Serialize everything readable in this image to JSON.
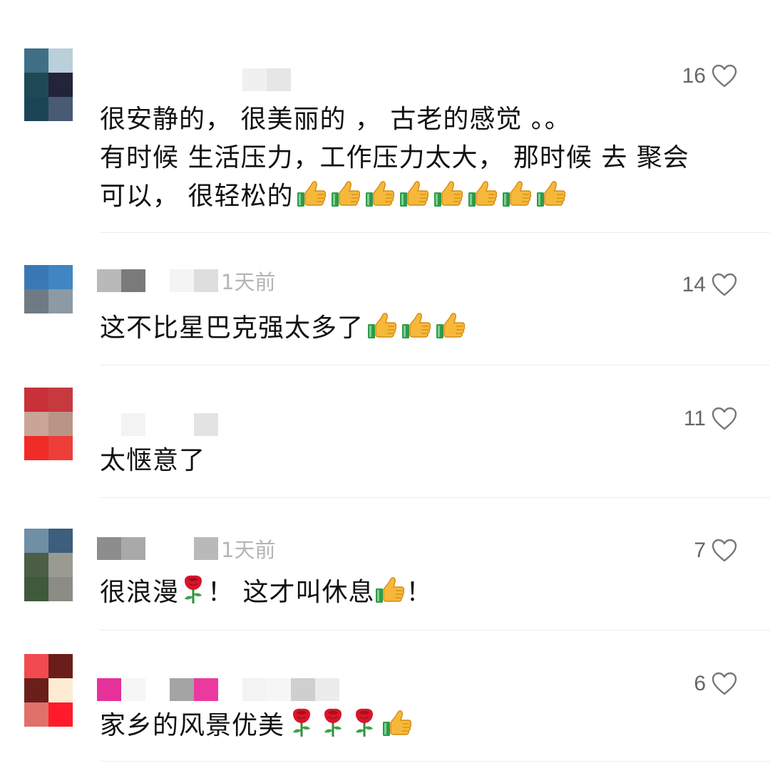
{
  "comments": [
    {
      "time": "",
      "likes": "16",
      "lines": [
        "很安静的， 很美丽的 ， 古老的感觉 。。",
        "有时候 生活压力，工作压力太大， 那时候 去 聚会",
        "可以， 很轻松的"
      ],
      "trailing_emoji": [
        "thumbs-up",
        "thumbs-up",
        "thumbs-up",
        "thumbs-up",
        "thumbs-up",
        "thumbs-up",
        "thumbs-up",
        "thumbs-up"
      ]
    },
    {
      "time": "1天前",
      "likes": "14",
      "lines": [
        "这不比星巴克强太多了"
      ],
      "trailing_emoji": [
        "thumbs-up",
        "thumbs-up",
        "thumbs-up"
      ]
    },
    {
      "time": "",
      "likes": "11",
      "lines": [
        "太惬意了"
      ],
      "trailing_emoji": []
    },
    {
      "time": "1天前",
      "likes": "7",
      "text_parts": [
        "很浪漫",
        "！ 这才叫休息",
        "！"
      ]
    },
    {
      "time": "",
      "likes": "6",
      "lines": [
        "家乡的风景优美"
      ],
      "trailing_emoji": [
        "rose",
        "rose",
        "rose",
        "thumbs-up"
      ]
    }
  ],
  "colors": {
    "text": "#111111",
    "time": "#b5b5b5",
    "like_count": "#666666",
    "divider": "#ececec"
  },
  "icons": [
    "heart-outline-icon",
    "thumbs-up-icon",
    "rose-icon"
  ]
}
